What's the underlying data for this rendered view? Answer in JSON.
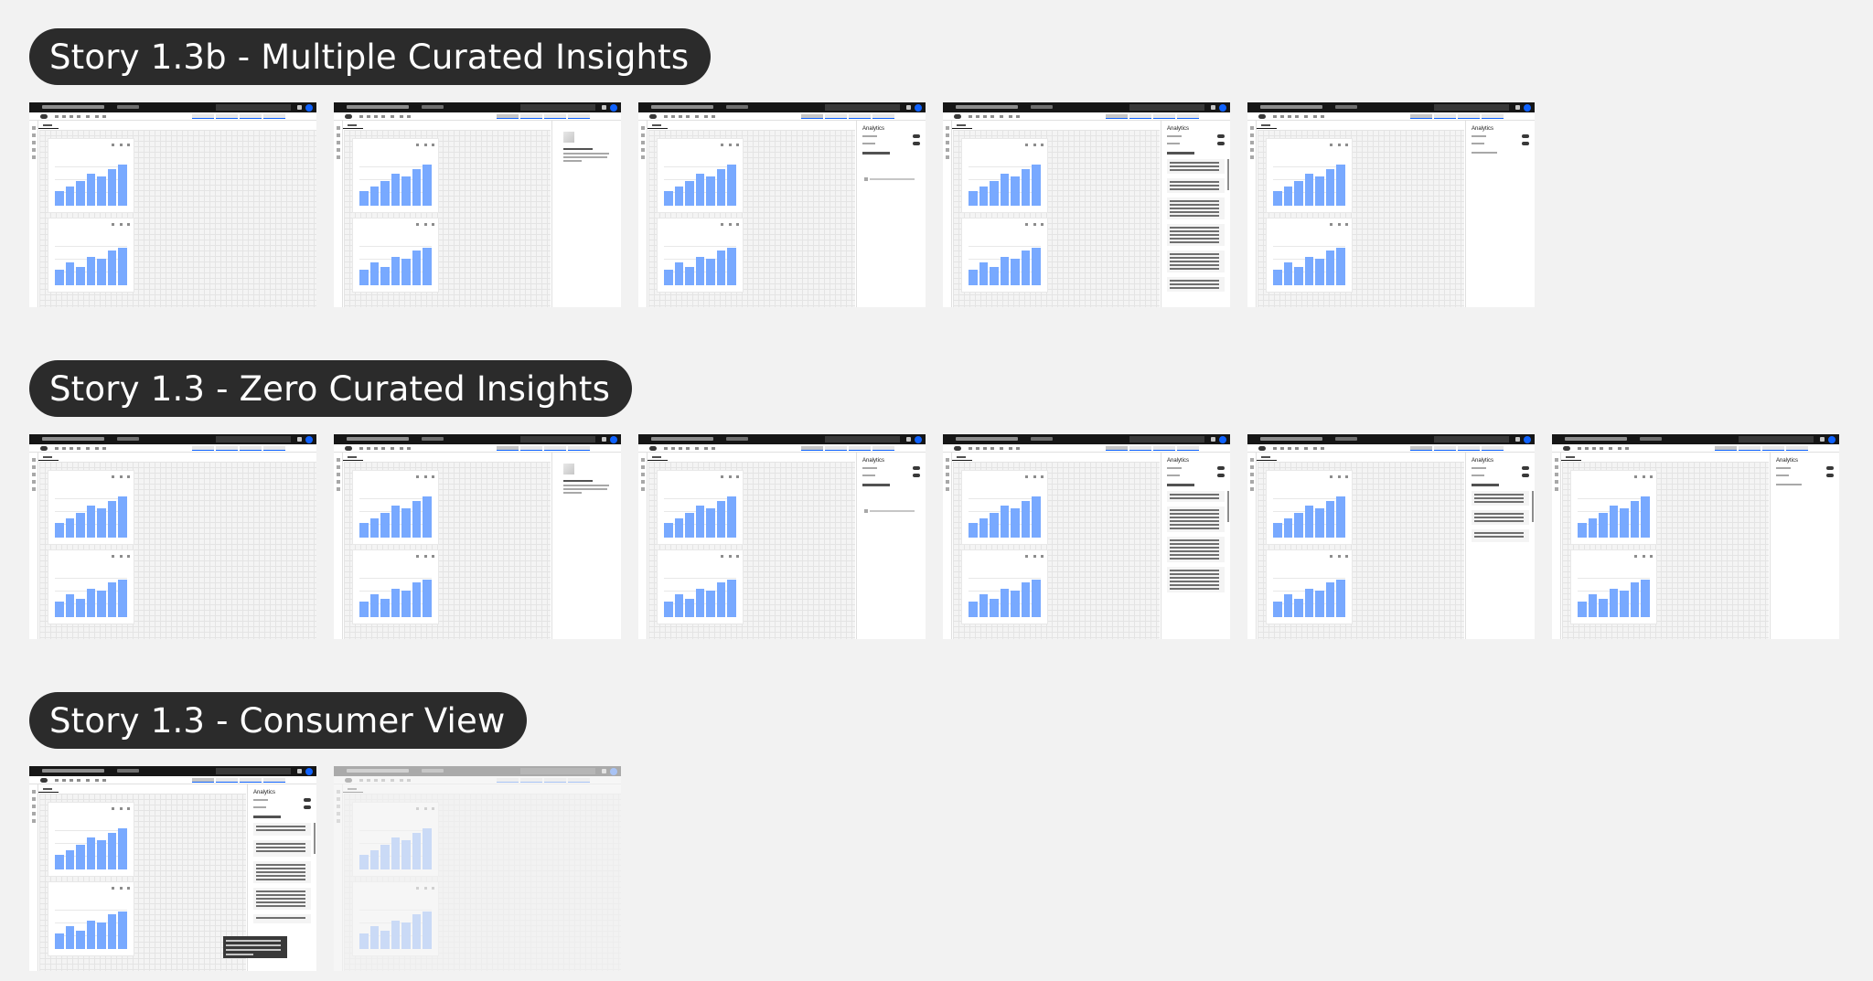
{
  "stories": [
    {
      "label": "Story 1.3b - Multiple Curated Insights",
      "frames": [
        {
          "panel": "none"
        },
        {
          "panel": "no-widget"
        },
        {
          "panel": "analytics",
          "state": "empty"
        },
        {
          "panel": "analytics",
          "state": "insights-list"
        },
        {
          "panel": "analytics",
          "state": "collapsed"
        }
      ]
    },
    {
      "label": "Story 1.3 - Zero Curated Insights",
      "frames": [
        {
          "panel": "none"
        },
        {
          "panel": "no-widget"
        },
        {
          "panel": "analytics",
          "state": "empty"
        },
        {
          "panel": "analytics",
          "state": "suggested-list"
        },
        {
          "panel": "analytics",
          "state": "mixed"
        },
        {
          "panel": "analytics",
          "state": "collapsed"
        }
      ]
    },
    {
      "label": "Story 1.3 - Consumer View",
      "frames": [
        {
          "panel": "analytics",
          "state": "consumer"
        },
        {
          "panel": "none",
          "faded": true
        }
      ]
    }
  ],
  "thumbnail": {
    "panel_title": "Analytics",
    "chart_values": [
      28,
      38,
      48,
      62,
      58,
      72,
      80
    ],
    "chart_values_alt": [
      30,
      44,
      36,
      56,
      52,
      68,
      74
    ],
    "accent": "#0f62fe",
    "bar_color": "#78a9ff",
    "topbar_color": "#161616"
  }
}
